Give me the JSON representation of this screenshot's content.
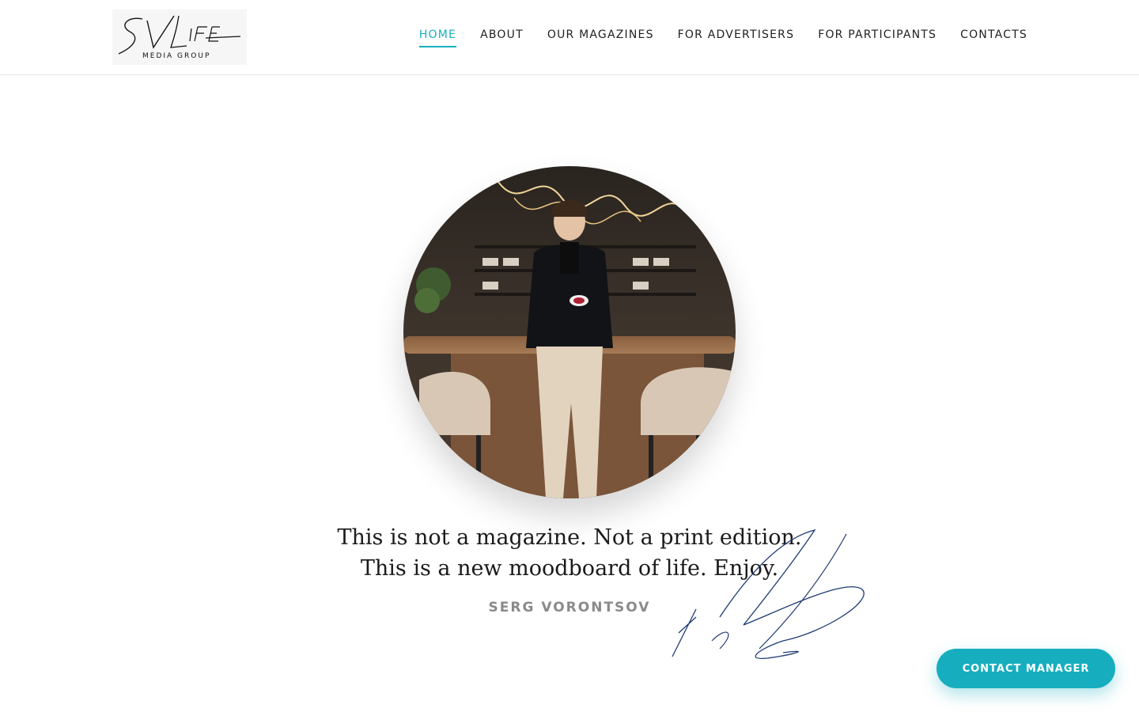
{
  "header": {
    "logo": {
      "wordmark": "SV LIFE",
      "tagline": "MEDIA GROUP"
    },
    "nav": [
      {
        "label": "HOME",
        "active": true
      },
      {
        "label": "ABOUT",
        "active": false
      },
      {
        "label": "OUR MAGAZINES",
        "active": false
      },
      {
        "label": "FOR ADVERTISERS",
        "active": false
      },
      {
        "label": "FOR PARTICIPANTS",
        "active": false
      },
      {
        "label": "CONTACTS",
        "active": false
      }
    ]
  },
  "hero": {
    "quote_line1": "This is not a magazine. Not a print edition.",
    "quote_line2": "This is a new moodboard of life. Enjoy.",
    "author": "SERG VORONTSOV"
  },
  "cta": {
    "label": "CONTACT MANAGER"
  },
  "colors": {
    "accent": "#16aebf",
    "text": "#1a1a1a",
    "muted": "#8a8a8a",
    "signature": "#1e3a73"
  }
}
